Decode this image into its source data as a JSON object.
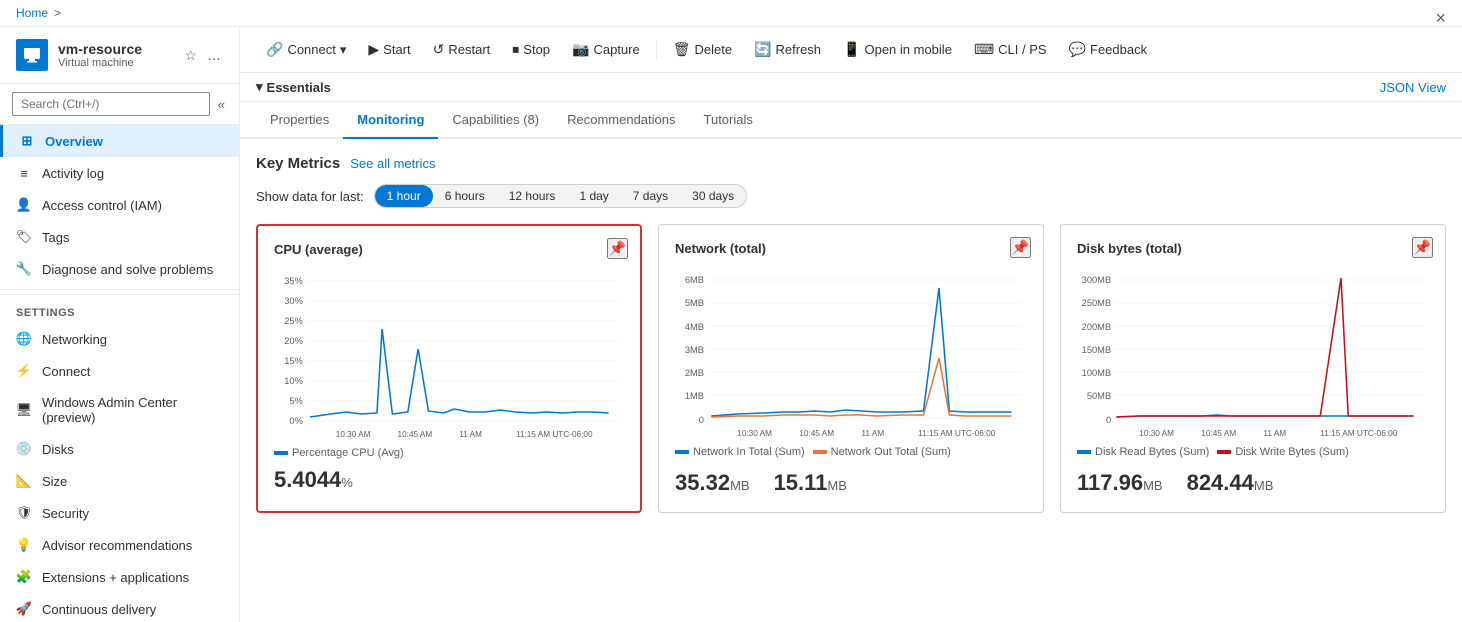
{
  "breadcrumb": {
    "home": "Home",
    "separator": ">"
  },
  "window": {
    "title": "vm-resource",
    "subtitle": "Virtual machine",
    "close_label": "×"
  },
  "search": {
    "placeholder": "Search (Ctrl+/)"
  },
  "toolbar": {
    "connect_label": "Connect",
    "start_label": "Start",
    "restart_label": "Restart",
    "stop_label": "Stop",
    "capture_label": "Capture",
    "delete_label": "Delete",
    "refresh_label": "Refresh",
    "open_mobile_label": "Open in mobile",
    "cli_ps_label": "CLI / PS",
    "feedback_label": "Feedback"
  },
  "essentials": {
    "label": "Essentials",
    "json_view": "JSON View"
  },
  "tabs": [
    {
      "id": "properties",
      "label": "Properties"
    },
    {
      "id": "monitoring",
      "label": "Monitoring",
      "active": true
    },
    {
      "id": "capabilities",
      "label": "Capabilities (8)"
    },
    {
      "id": "recommendations",
      "label": "Recommendations"
    },
    {
      "id": "tutorials",
      "label": "Tutorials"
    }
  ],
  "monitoring": {
    "key_metrics_title": "Key Metrics",
    "see_metrics_label": "See all metrics",
    "time_filter_label": "Show data for last:",
    "time_options": [
      {
        "id": "1h",
        "label": "1 hour",
        "active": true
      },
      {
        "id": "6h",
        "label": "6 hours"
      },
      {
        "id": "12h",
        "label": "12 hours"
      },
      {
        "id": "1d",
        "label": "1 day"
      },
      {
        "id": "7d",
        "label": "7 days"
      },
      {
        "id": "30d",
        "label": "30 days"
      }
    ],
    "charts": [
      {
        "id": "cpu",
        "title": "CPU (average)",
        "selected": true,
        "legend": [
          {
            "label": "Percentage CPU (Avg)",
            "color": "#0078d4"
          }
        ],
        "value": "5.4044",
        "unit": "%",
        "x_labels": [
          "10:30 AM",
          "10:45 AM",
          "11 AM",
          "11:15 AM UTC-06:00"
        ],
        "y_labels": [
          "35%",
          "30%",
          "25%",
          "20%",
          "15%",
          "10%",
          "5%",
          "0%"
        ]
      },
      {
        "id": "network",
        "title": "Network (total)",
        "selected": false,
        "legend": [
          {
            "label": "Network In Total (Sum)",
            "color": "#0078d4"
          },
          {
            "label": "Network Out Total (Sum)",
            "color": "#e8763a"
          }
        ],
        "values": [
          {
            "amount": "35.32",
            "unit": "MB"
          },
          {
            "amount": "15.11",
            "unit": "MB"
          }
        ],
        "x_labels": [
          "10:30 AM",
          "10:45 AM",
          "11 AM",
          "11:15 AM UTC-06:00"
        ],
        "y_labels": [
          "6MB",
          "5MB",
          "4MB",
          "3MB",
          "2MB",
          "1MB",
          "0"
        ]
      },
      {
        "id": "disk",
        "title": "Disk bytes (total)",
        "selected": false,
        "legend": [
          {
            "label": "Disk Read Bytes (Sum)",
            "color": "#0078d4"
          },
          {
            "label": "Disk Write Bytes (Sum)",
            "color": "#c50f1f"
          }
        ],
        "values": [
          {
            "amount": "117.96",
            "unit": "MB"
          },
          {
            "amount": "824.44",
            "unit": "MB"
          }
        ],
        "x_labels": [
          "10:30 AM",
          "10:45 AM",
          "11 AM",
          "11:15 AM UTC-06:00"
        ],
        "y_labels": [
          "300MB",
          "250MB",
          "200MB",
          "150MB",
          "100MB",
          "50MB",
          "0"
        ]
      }
    ]
  },
  "sidebar": {
    "nav_items": [
      {
        "id": "overview",
        "label": "Overview",
        "active": true,
        "icon": "grid"
      },
      {
        "id": "activity-log",
        "label": "Activity log",
        "active": false,
        "icon": "list"
      },
      {
        "id": "access-control",
        "label": "Access control (IAM)",
        "active": false,
        "icon": "person"
      },
      {
        "id": "tags",
        "label": "Tags",
        "active": false,
        "icon": "tag"
      },
      {
        "id": "diagnose",
        "label": "Diagnose and solve problems",
        "active": false,
        "icon": "wrench"
      }
    ],
    "settings_title": "Settings",
    "settings_items": [
      {
        "id": "networking",
        "label": "Networking",
        "icon": "network"
      },
      {
        "id": "connect",
        "label": "Connect",
        "icon": "connect"
      },
      {
        "id": "windows-admin",
        "label": "Windows Admin Center (preview)",
        "icon": "admin"
      },
      {
        "id": "disks",
        "label": "Disks",
        "icon": "disk"
      },
      {
        "id": "size",
        "label": "Size",
        "icon": "size"
      },
      {
        "id": "security",
        "label": "Security",
        "icon": "shield"
      },
      {
        "id": "advisor",
        "label": "Advisor recommendations",
        "icon": "advisor"
      },
      {
        "id": "extensions",
        "label": "Extensions + applications",
        "icon": "extensions"
      },
      {
        "id": "continuous-delivery",
        "label": "Continuous delivery",
        "icon": "delivery"
      }
    ]
  }
}
